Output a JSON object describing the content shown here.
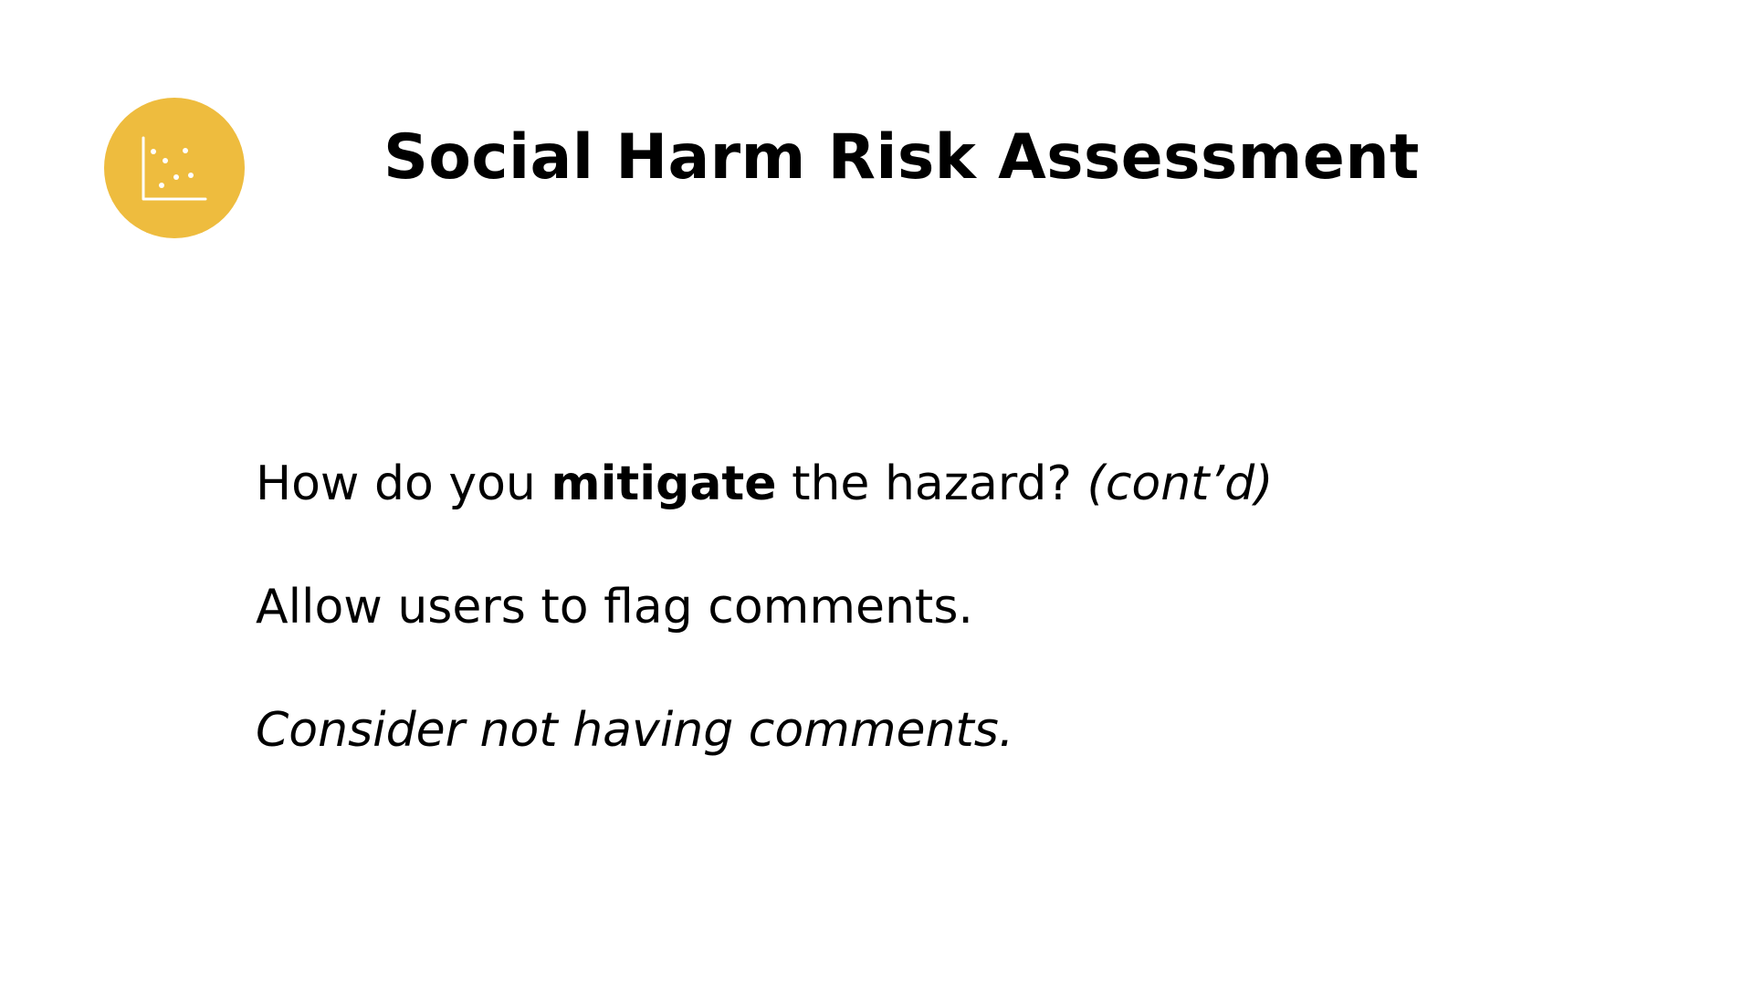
{
  "slide": {
    "title": "Social Harm Risk Assessment",
    "badge_icon": "scatter-plot-icon",
    "accent_color": "#EEBC3E",
    "question": {
      "before": "How do you ",
      "emphasis": "mitigate",
      "after": " the hazard? ",
      "note": "(cont’d)"
    },
    "point_1": "Allow users to flag comments.",
    "point_2": "Consider not having comments."
  }
}
